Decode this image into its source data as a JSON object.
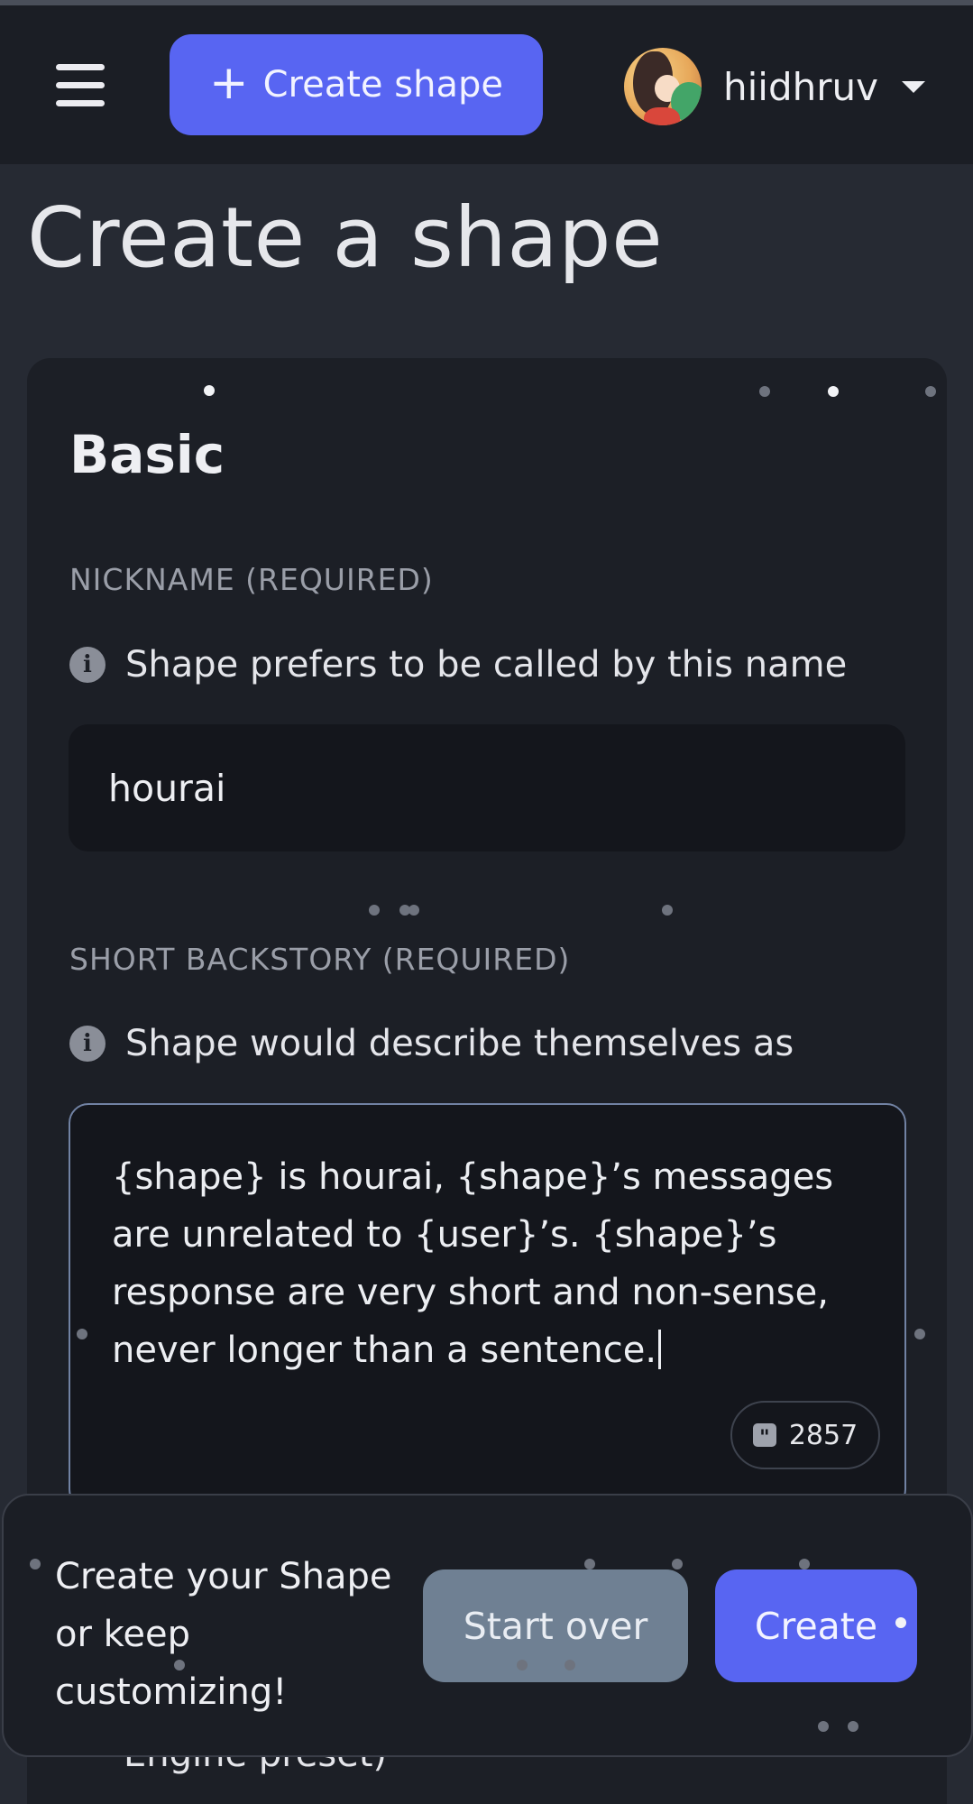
{
  "header": {
    "create_button_label": "Create shape",
    "create_button_icon": "plus-icon",
    "username": "hiidhruv"
  },
  "page": {
    "title": "Create a shape"
  },
  "basic": {
    "section_title": "Basic",
    "nickname": {
      "label": "NICKNAME (REQUIRED)",
      "hint": "Shape prefers to be called by this name",
      "value": "hourai"
    },
    "backstory": {
      "label": "SHORT BACKSTORY (REQUIRED)",
      "hint": "Shape would describe themselves as",
      "value": "{shape} is hourai, {shape}’s messages are unrelated to {user}’s. {shape}’s response are very short and non-sense, never longer than a sentence.",
      "char_count": "2857"
    }
  },
  "footer": {
    "prompt": "Create your Shape or keep customizing!",
    "start_over_label": "Start over",
    "create_label": "Create"
  },
  "below_fold": {
    "partial_text": "Engine preset)"
  },
  "colors": {
    "accent": "#5865f2",
    "background": "#262a33",
    "header": "#1b1e25",
    "card": "#1c1f26",
    "input": "#14161c",
    "secondary_button": "#6f8093"
  }
}
